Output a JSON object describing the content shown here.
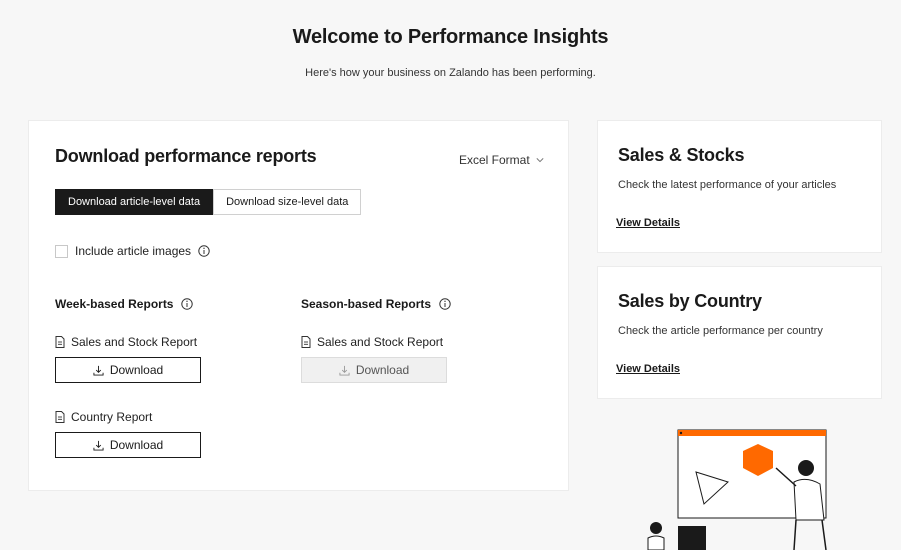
{
  "header": {
    "title": "Welcome to Performance Insights",
    "subtitle": "Here's how your business on Zalando has been performing."
  },
  "reports": {
    "title": "Download performance reports",
    "format_label": "Excel Format",
    "tabs": [
      {
        "label": "Download article-level data",
        "active": true
      },
      {
        "label": "Download size-level data",
        "active": false
      }
    ],
    "include_images_label": "Include article images",
    "include_images_checked": false,
    "week_section": {
      "title": "Week-based Reports",
      "items": [
        {
          "name": "Sales and Stock Report",
          "button": "Download",
          "enabled": true
        },
        {
          "name": "Country Report",
          "button": "Download",
          "enabled": true
        }
      ]
    },
    "season_section": {
      "title": "Season-based Reports",
      "items": [
        {
          "name": "Sales and Stock Report",
          "button": "Download",
          "enabled": false
        }
      ]
    }
  },
  "sales_stocks": {
    "title": "Sales & Stocks",
    "description": "Check the latest performance of your articles",
    "link": "View Details"
  },
  "sales_country": {
    "title": "Sales by Country",
    "description": "Check the article performance per country",
    "link": "View Details"
  },
  "colors": {
    "accent": "#ff6900",
    "dark": "#1a1a1a",
    "background": "#f7f7f7"
  }
}
